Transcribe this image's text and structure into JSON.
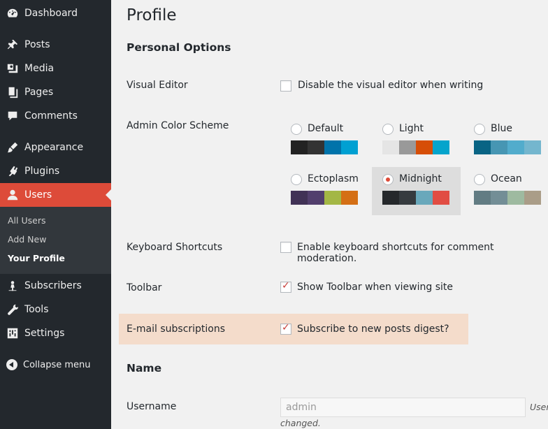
{
  "sidebar": {
    "items": [
      {
        "label": "Dashboard",
        "icon": "dashboard-icon"
      },
      {
        "label": "Posts",
        "icon": "pin-icon"
      },
      {
        "label": "Media",
        "icon": "media-icon"
      },
      {
        "label": "Pages",
        "icon": "pages-icon"
      },
      {
        "label": "Comments",
        "icon": "comments-icon"
      },
      {
        "label": "Appearance",
        "icon": "brush-icon"
      },
      {
        "label": "Plugins",
        "icon": "plugin-icon"
      },
      {
        "label": "Users",
        "icon": "users-icon"
      },
      {
        "label": "Subscribers",
        "icon": "subscribers-icon"
      },
      {
        "label": "Tools",
        "icon": "wrench-icon"
      },
      {
        "label": "Settings",
        "icon": "settings-icon"
      }
    ],
    "submenu": [
      "All Users",
      "Add New",
      "Your Profile"
    ],
    "collapse_label": "Collapse menu",
    "accent": "#dd4b39"
  },
  "page_title": "Profile",
  "personal_options": {
    "title": "Personal Options",
    "visual_editor": {
      "label": "Visual Editor",
      "checkbox_label": "Disable the visual editor when writing",
      "checked": false
    },
    "color_scheme": {
      "label": "Admin Color Scheme",
      "selected": "Midnight",
      "schemes": [
        {
          "name": "Default",
          "colors": [
            "#222222",
            "#333333",
            "#0073aa",
            "#00a0d2"
          ]
        },
        {
          "name": "Light",
          "colors": [
            "#e5e5e5",
            "#999999",
            "#d64e07",
            "#04a4cc"
          ]
        },
        {
          "name": "Blue",
          "colors": [
            "#096484",
            "#4796b3",
            "#52accc",
            "#74b6ce"
          ]
        },
        {
          "name": "Ectoplasm",
          "colors": [
            "#413256",
            "#523f6d",
            "#a3b745",
            "#d46f15"
          ]
        },
        {
          "name": "Midnight",
          "colors": [
            "#25282b",
            "#363b3f",
            "#69a8bb",
            "#e14d43"
          ]
        },
        {
          "name": "Ocean",
          "colors": [
            "#627c83",
            "#738e96",
            "#9ebaa0",
            "#aa9d88"
          ]
        }
      ]
    },
    "keyboard_shortcuts": {
      "label": "Keyboard Shortcuts",
      "checkbox_label": "Enable keyboard shortcuts for comment moderation.",
      "checked": false
    },
    "toolbar": {
      "label": "Toolbar",
      "checkbox_label": "Show Toolbar when viewing site",
      "checked": true
    },
    "email_subscriptions": {
      "label": "E-mail subscriptions",
      "checkbox_label": "Subscribe to new posts digest?",
      "checked": true
    }
  },
  "name_section": {
    "title": "Name",
    "username": {
      "label": "Username",
      "value": "admin",
      "desc_right": "User",
      "desc_below": "changed."
    }
  }
}
